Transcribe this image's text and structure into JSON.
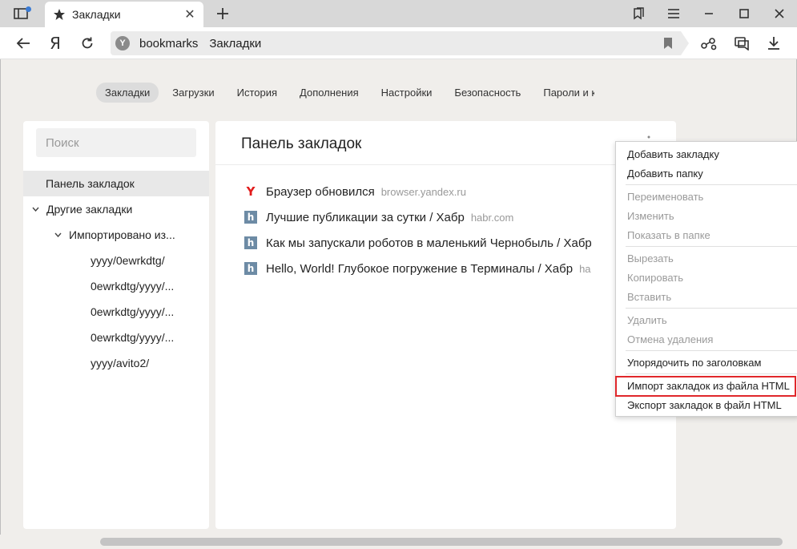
{
  "browser": {
    "tab": {
      "title": "Закладки",
      "icon": "star-icon"
    },
    "window_buttons": [
      "bookmarks-icon",
      "menu-icon",
      "minimize-icon",
      "maximize-icon",
      "close-icon"
    ],
    "address": {
      "yandex_logo": "Я",
      "host": "bookmarks",
      "page_title": "Закладки"
    }
  },
  "settings_tabs": [
    {
      "label": "Закладки",
      "active": true
    },
    {
      "label": "Загрузки",
      "active": false
    },
    {
      "label": "История",
      "active": false
    },
    {
      "label": "Дополнения",
      "active": false
    },
    {
      "label": "Настройки",
      "active": false
    },
    {
      "label": "Безопасность",
      "active": false
    },
    {
      "label": "Пароли и ка",
      "active": false
    }
  ],
  "sidebar": {
    "search_placeholder": "Поиск",
    "items": [
      {
        "label": "Панель закладок"
      },
      {
        "label": "Другие закладки"
      },
      {
        "label": "Импортировано из..."
      },
      {
        "label": "yyyy/0ewrkdtg/"
      },
      {
        "label": "0ewrkdtg/yyyy/..."
      },
      {
        "label": "0ewrkdtg/yyyy/..."
      },
      {
        "label": "0ewrkdtg/yyyy/..."
      },
      {
        "label": "yyyy/avito2/"
      }
    ]
  },
  "main": {
    "title": "Панель закладок",
    "bookmarks": [
      {
        "title": "Браузер обновился",
        "url": "browser.yandex.ru",
        "icon": "yandex-icon",
        "glyph": "Y"
      },
      {
        "title": "Лучшие публикации за сутки / Хабр",
        "url": "habr.com",
        "icon": "habr-icon",
        "glyph": "h"
      },
      {
        "title": "Как мы запускали роботов в маленький Чернобыль / Хабр",
        "url": "",
        "icon": "habr-icon",
        "glyph": "h"
      },
      {
        "title": "Hello, World! Глубокое погружение в Терминалы / Хабр",
        "url": "ha",
        "icon": "habr-icon",
        "glyph": "h"
      }
    ]
  },
  "context_menu": {
    "items": [
      {
        "label": "Добавить закладку",
        "enabled": true
      },
      {
        "label": "Добавить папку",
        "enabled": true
      },
      {
        "label": "Переименовать",
        "enabled": false
      },
      {
        "label": "Изменить",
        "enabled": false
      },
      {
        "label": "Показать в папке",
        "enabled": false
      },
      {
        "label": "Вырезать",
        "enabled": false
      },
      {
        "label": "Копировать",
        "enabled": false
      },
      {
        "label": "Вставить",
        "enabled": false
      },
      {
        "label": "Удалить",
        "enabled": false
      },
      {
        "label": "Отмена удаления",
        "enabled": false
      },
      {
        "label": "Упорядочить по заголовкам",
        "enabled": true
      },
      {
        "label": "Импорт закладок из файла HTML",
        "enabled": true,
        "highlighted": true
      },
      {
        "label": "Экспорт закладок в файл HTML",
        "enabled": true
      }
    ],
    "highlight_color": "#e0272b"
  }
}
